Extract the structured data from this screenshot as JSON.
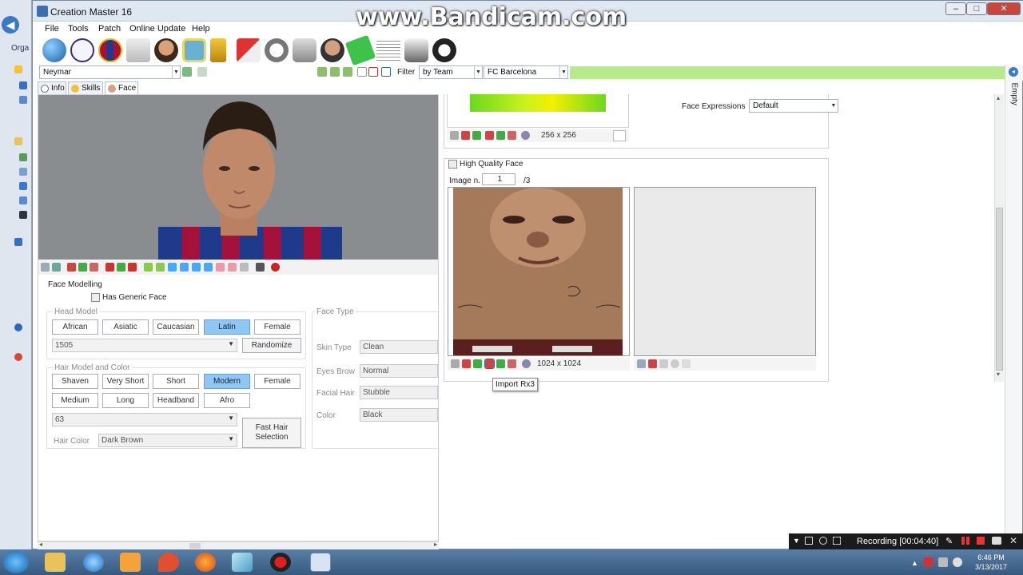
{
  "window": {
    "title": "Creation Master 16",
    "watermark": "www.Bandicam.com"
  },
  "background": {
    "organize_label": "Orga"
  },
  "menu": [
    "File",
    "Tools",
    "Patch",
    "Online Update",
    "Help"
  ],
  "toolbar_icons": [
    "globe-icon",
    "premier-league-icon",
    "fc-barcelona-crest-icon",
    "jersey-icon",
    "player-icon",
    "stadium-icon",
    "trophy-icon",
    "boots-icon",
    "ball-icon",
    "shoe-icon",
    "manager-icon",
    "pitch-icon",
    "newspaper-icon",
    "gloves-icon",
    "headphones-icon"
  ],
  "filterbar": {
    "player": "Neymar",
    "filter_label": "Filter",
    "filter_by": "by Team",
    "team": "FC Barcelona",
    "side_label": "Empty"
  },
  "tabs": [
    "Info",
    "Skills",
    "Face"
  ],
  "face_modelling": {
    "title": "Face Modelling",
    "generic_face": "Has Generic Face",
    "head_model_title": "Head Model",
    "head_models": [
      "African",
      "Asiatic",
      "Caucasian",
      "Latin",
      "Female"
    ],
    "head_selected": "Latin",
    "head_number": "1505",
    "randomize": "Randomize",
    "hair_title": "Hair Model and Color",
    "hair_row1": [
      "Shaven",
      "Very Short",
      "Short",
      "Modern",
      "Female"
    ],
    "hair_row2": [
      "Medium",
      "Long",
      "Headband",
      "Afro"
    ],
    "hair_selected": "Modern",
    "hair_number": "63",
    "hair_color_label": "Hair Color",
    "hair_color": "Dark Brown",
    "fast_hair": "Fast Hair Selection"
  },
  "face_type": {
    "title": "Face Type",
    "skin_label": "Skin Type",
    "skin": "Clean",
    "brow_label": "Eyes Brow",
    "brow": "Normal",
    "facial_label": "Facial Hair",
    "facial": "Stubble",
    "color_label": "Color",
    "color": "Black"
  },
  "right": {
    "tex_size_small": "256 x 256",
    "face_expr_label": "Face Expressions",
    "face_expr": "Default",
    "hq_face": "High Quality Face",
    "image_n_label": "Image n.",
    "image_n": "1",
    "image_total": "/3",
    "tex_size_large": "1024 x 1024",
    "tooltip": "Import Rx3"
  },
  "recording": {
    "label": "Recording [00:04:40]"
  },
  "clock": {
    "time": "6:46 PM",
    "date": "3/13/2017"
  }
}
